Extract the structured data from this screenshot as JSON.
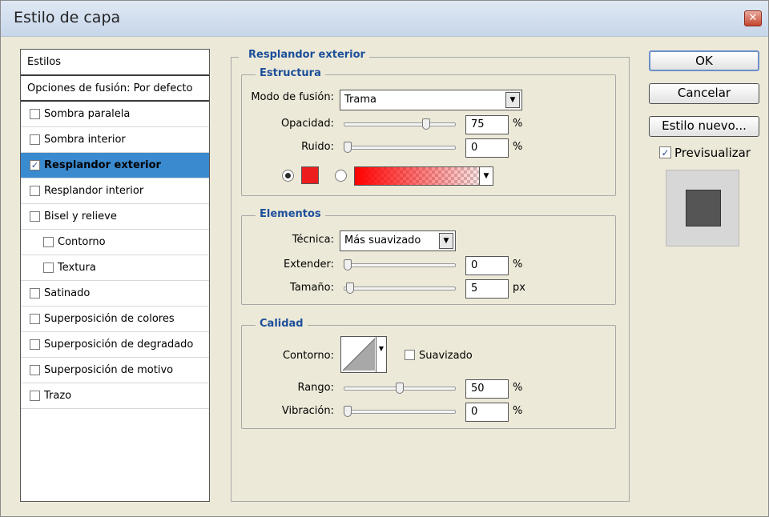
{
  "window": {
    "title": "Estilo de capa",
    "close_glyph": "✕"
  },
  "styles_panel": {
    "header": "Estilos",
    "blend_options": "Opciones de fusión: Por defecto",
    "items": [
      {
        "label": "Sombra paralela",
        "checked": false
      },
      {
        "label": "Sombra interior",
        "checked": false
      },
      {
        "label": "Resplandor exterior",
        "checked": true,
        "selected": true
      },
      {
        "label": "Resplandor interior",
        "checked": false
      },
      {
        "label": "Bisel y relieve",
        "checked": false
      },
      {
        "label": "Contorno",
        "checked": false,
        "sub": true
      },
      {
        "label": "Textura",
        "checked": false,
        "sub": true
      },
      {
        "label": "Satinado",
        "checked": false
      },
      {
        "label": "Superposición de colores",
        "checked": false
      },
      {
        "label": "Superposición de degradado",
        "checked": false
      },
      {
        "label": "Superposición de motivo",
        "checked": false
      },
      {
        "label": "Trazo",
        "checked": false
      }
    ]
  },
  "outer_glow": {
    "title": "Resplandor exterior",
    "structure": {
      "title": "Estructura",
      "blend_mode_label": "Modo de fusión:",
      "blend_mode": "Trama",
      "opacity_label": "Opacidad:",
      "opacity": "75",
      "opacity_fraction": 0.75,
      "noise_label": "Ruido:",
      "noise": "0",
      "noise_fraction": 0,
      "unit": "%",
      "glow_color": "#ee1d1d",
      "gradient_color": "#ff0000"
    },
    "elements": {
      "title": "Elementos",
      "technique_label": "Técnica:",
      "technique": "Más suavizado",
      "spread_label": "Extender:",
      "spread": "0",
      "spread_fraction": 0,
      "size_label": "Tamaño:",
      "size": "5",
      "size_fraction": 0.02,
      "percent": "%",
      "px": "px"
    },
    "quality": {
      "title": "Calidad",
      "contour_label": "Contorno:",
      "antialias_label": "Suavizado",
      "range_label": "Rango:",
      "range": "50",
      "range_fraction": 0.5,
      "jitter_label": "Vibración:",
      "jitter": "0",
      "jitter_fraction": 0,
      "unit": "%"
    }
  },
  "buttons": {
    "ok": "OK",
    "cancel": "Cancelar",
    "new_style": "Estilo nuevo..."
  },
  "preview": {
    "label": "Previsualizar",
    "checked": true
  }
}
